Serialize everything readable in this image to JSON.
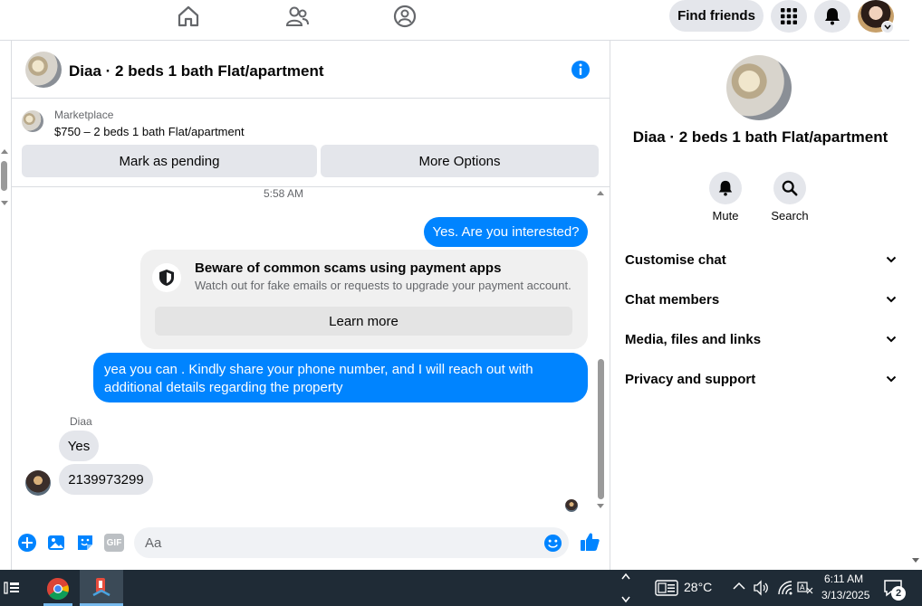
{
  "topbar": {
    "find_friends": "Find friends",
    "icons": [
      "home-icon",
      "friends-icon",
      "groups-icon",
      "apps-grid-icon",
      "bell-icon",
      "profile-avatar"
    ]
  },
  "chat": {
    "title": "Diaa · 2 beds 1 bath Flat/apartment",
    "marketplace_label": "Marketplace",
    "listing": "$750 – 2 beds 1 bath Flat/apartment",
    "mark_pending": "Mark as pending",
    "more_options": "More Options",
    "timestamp": "5:58 AM",
    "msg1": "Yes. Are you interested?",
    "scam_title": "Beware of common scams using payment apps",
    "scam_body": "Watch out for fake emails or requests to upgrade your payment account.",
    "learn_more": "Learn more",
    "msg2_line1": "yea you can . Kindly share your phone number, and I will reach out with",
    "msg2_line2": "additional details regarding the property",
    "sender": "Diaa",
    "msg3": "Yes",
    "msg4": "2139973299",
    "composer_placeholder": "Aa",
    "gif_label": "GIF"
  },
  "right": {
    "title": "Diaa · 2 beds 1 bath Flat/apartment",
    "mute": "Mute",
    "search": "Search",
    "items": [
      {
        "label": "Customise chat"
      },
      {
        "label": "Chat members"
      },
      {
        "label": "Media, files and links"
      },
      {
        "label": "Privacy and support"
      }
    ]
  },
  "taskbar": {
    "temperature": "28°C",
    "time": "6:11 AM",
    "date": "3/13/2025",
    "notif_count": "2"
  },
  "colors": {
    "accent": "#0084ff",
    "grey": "#e4e6eb",
    "taskbar": "#1f2b36"
  }
}
